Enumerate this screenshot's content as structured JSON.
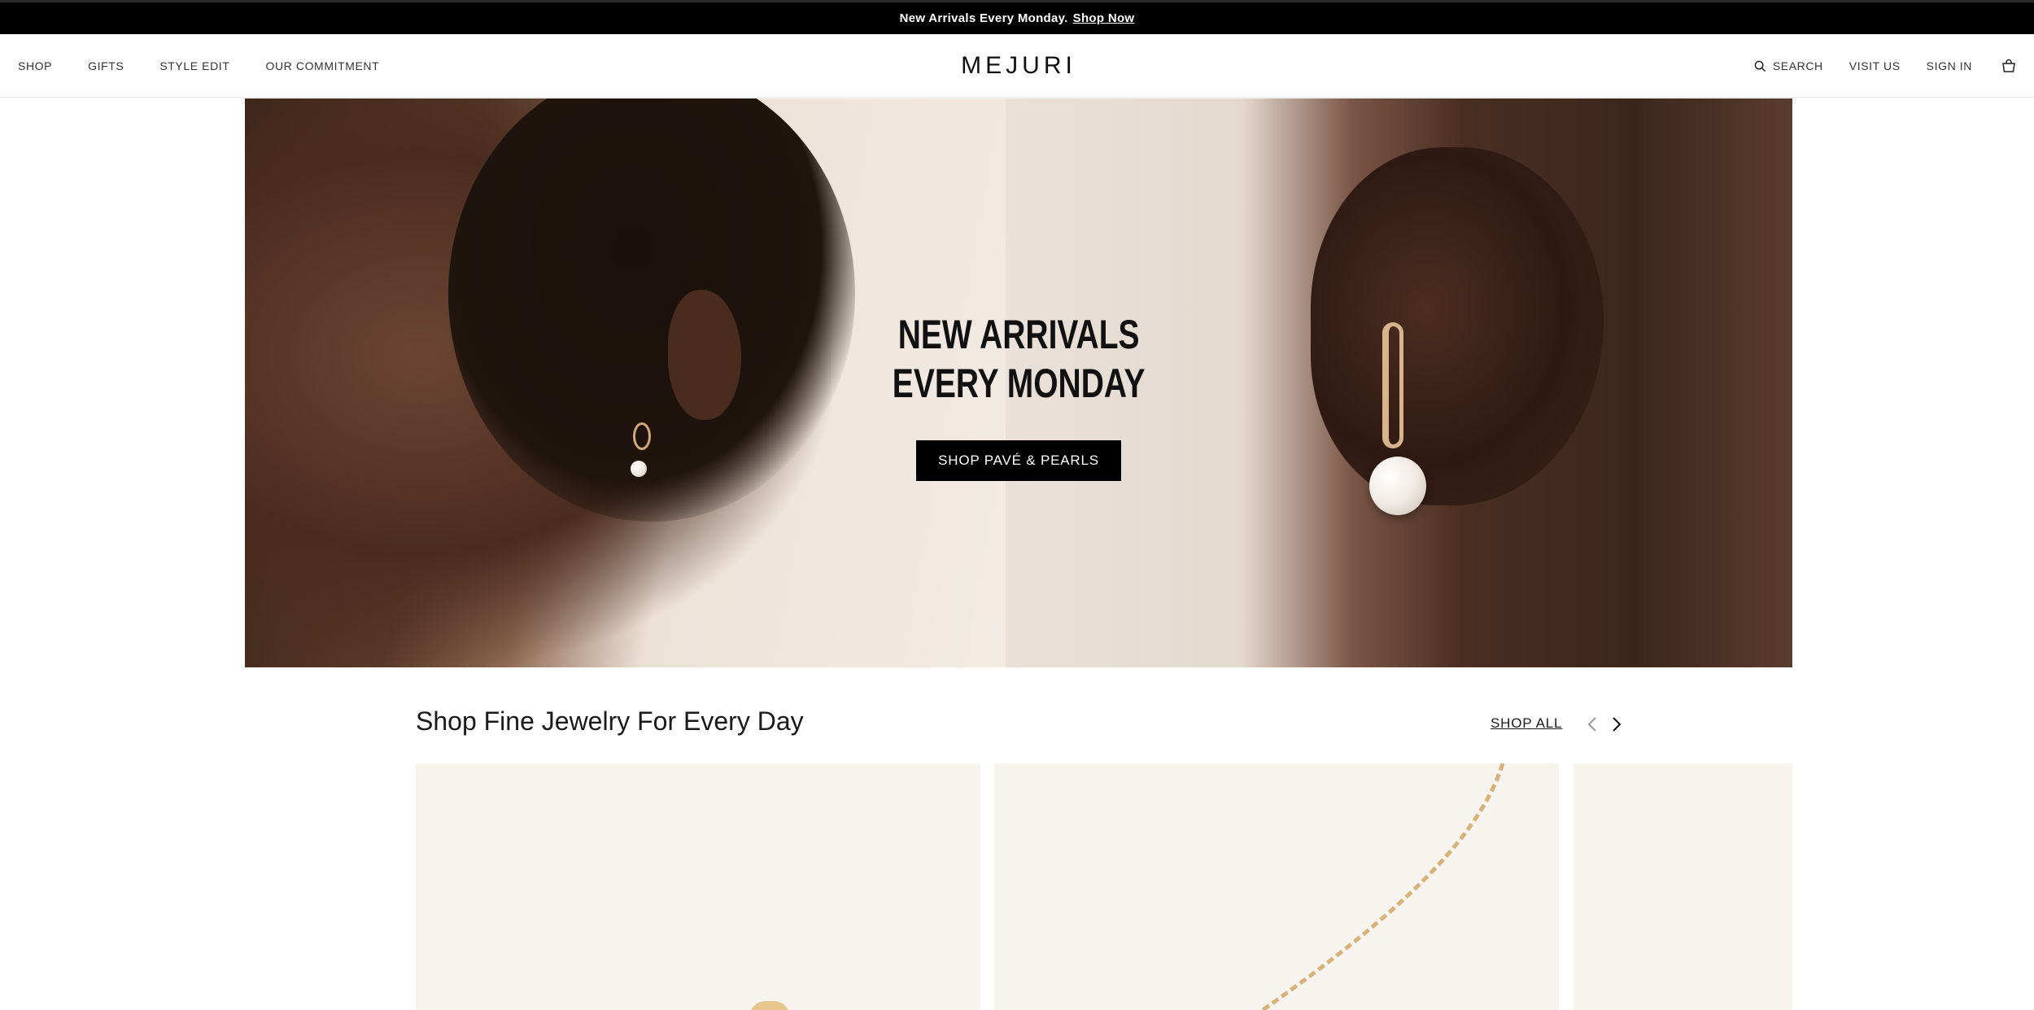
{
  "announcement": {
    "text": "New Arrivals Every Monday.",
    "link_label": "Shop Now"
  },
  "header": {
    "logo": "MEJURI",
    "nav_left": [
      "SHOP",
      "GIFTS",
      "STYLE EDIT",
      "OUR COMMITMENT"
    ],
    "search_label": "SEARCH",
    "visit_label": "VISIT US",
    "signin_label": "SIGN IN"
  },
  "hero": {
    "title_line1": "NEW ARRIVALS",
    "title_line2": "EVERY MONDAY",
    "cta_label": "SHOP PAVÉ & PEARLS"
  },
  "section": {
    "title": "Shop Fine Jewelry For Every Day",
    "shop_all_label": "SHOP ALL"
  },
  "colors": {
    "announcement_bg": "#000000",
    "cta_bg": "#000000",
    "card_bg": "#f7f4f0"
  },
  "icons": [
    "search-icon",
    "cart-icon",
    "chevron-left-icon",
    "chevron-right-icon"
  ]
}
